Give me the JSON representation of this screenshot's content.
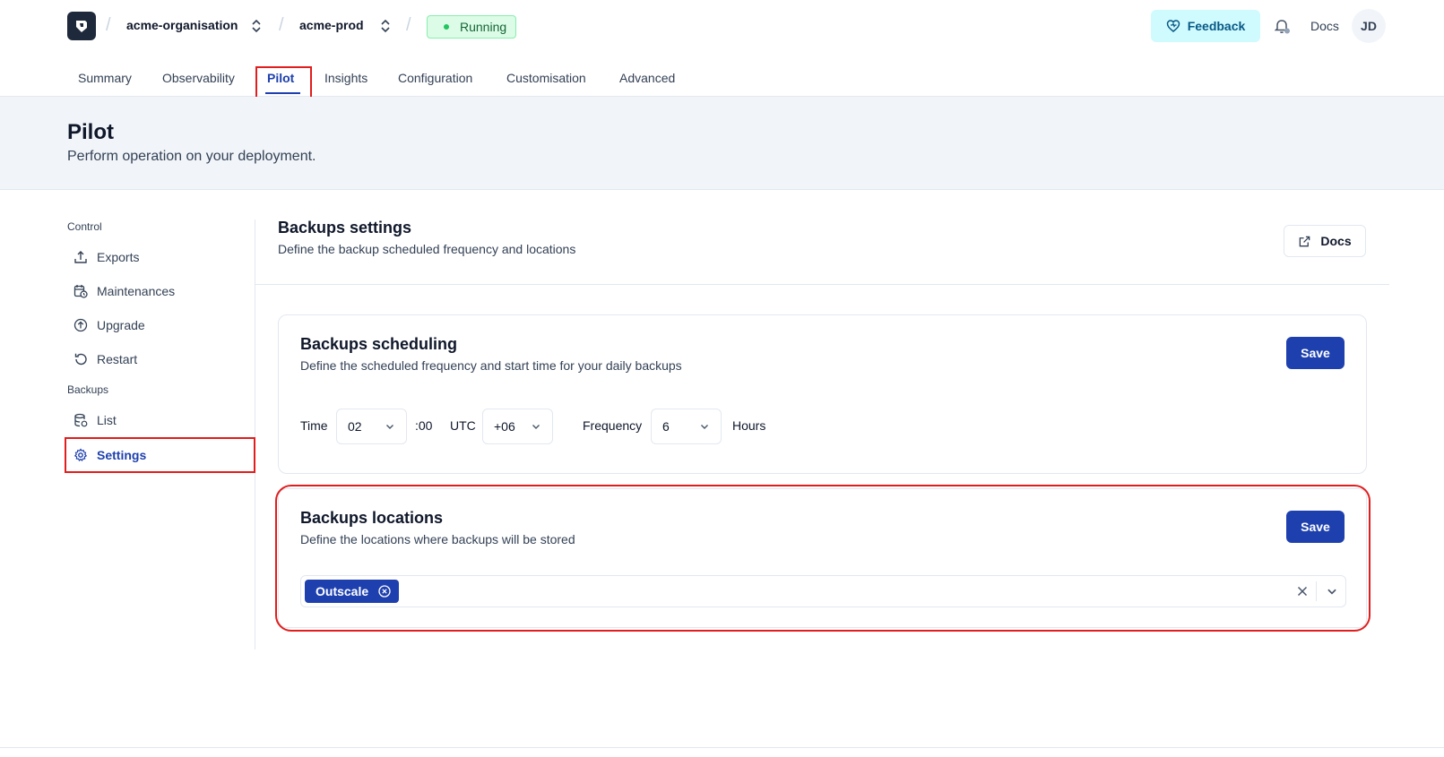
{
  "topbar": {
    "organisation": "acme-organisation",
    "project": "acme-prod",
    "status": "Running",
    "feedback_label": "Feedback",
    "docs_label": "Docs",
    "avatar_initials": "JD"
  },
  "tabs": [
    {
      "label": "Summary"
    },
    {
      "label": "Observability"
    },
    {
      "label": "Pilot"
    },
    {
      "label": "Insights"
    },
    {
      "label": "Configuration"
    },
    {
      "label": "Customisation"
    },
    {
      "label": "Advanced"
    }
  ],
  "active_tab": "Pilot",
  "header": {
    "title": "Pilot",
    "subtitle": "Perform operation on your deployment."
  },
  "sidebar": {
    "groups": [
      {
        "label": "Control",
        "items": [
          {
            "label": "Exports",
            "icon": "upload-icon"
          },
          {
            "label": "Maintenances",
            "icon": "calendar-clock-icon"
          },
          {
            "label": "Upgrade",
            "icon": "arrow-up-circle-icon"
          },
          {
            "label": "Restart",
            "icon": "rotate-ccw-icon"
          }
        ]
      },
      {
        "label": "Backups",
        "items": [
          {
            "label": "List",
            "icon": "database-icon"
          },
          {
            "label": "Settings",
            "icon": "gear-icon"
          }
        ]
      }
    ],
    "active_item": "Settings"
  },
  "main": {
    "title": "Backups settings",
    "description": "Define the backup scheduled frequency and locations",
    "docs_label": "Docs",
    "scheduling": {
      "title": "Backups scheduling",
      "description": "Define the scheduled frequency and start time for your daily backups",
      "save_label": "Save",
      "time_label": "Time",
      "hour_value": "02",
      "minutes_suffix": ":00",
      "utc_label": "UTC",
      "offset_value": "+06",
      "frequency_label": "Frequency",
      "frequency_value": "6",
      "hours_label": "Hours"
    },
    "locations": {
      "title": "Backups locations",
      "description": "Define the locations where backups will be stored",
      "save_label": "Save",
      "selected": [
        "Outscale"
      ]
    }
  },
  "colors": {
    "accent": "#1e40af",
    "highlight": "#e11d1d",
    "running_bg": "#dcfce7",
    "feedback_bg": "#cffafe"
  }
}
